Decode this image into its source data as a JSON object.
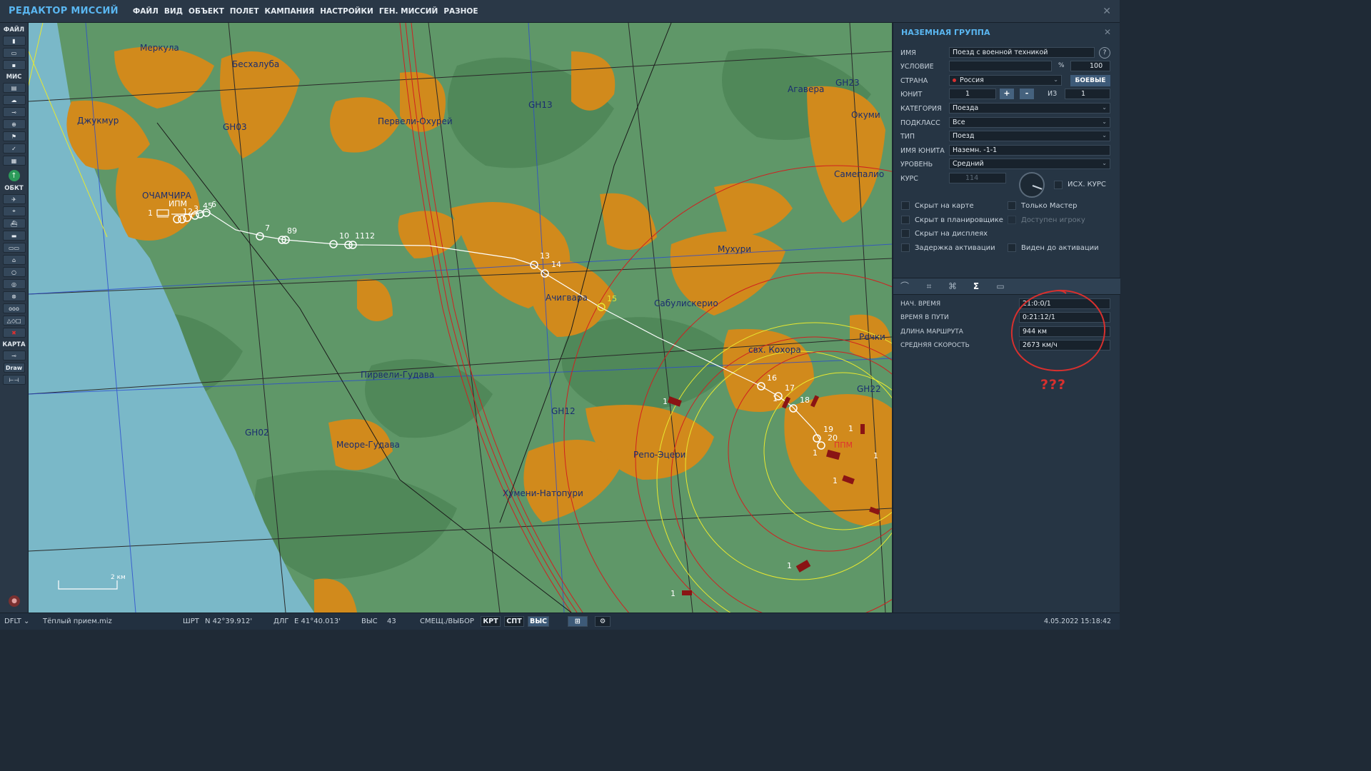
{
  "app": {
    "title": "РЕДАКТОР МИССИЙ"
  },
  "menu": [
    "ФАЙЛ",
    "ВИД",
    "ОБЪЕКТ",
    "ПОЛЕТ",
    "КАМПАНИЯ",
    "НАСТРОЙКИ",
    "ГЕН. МИССИЙ",
    "РАЗНОЕ"
  ],
  "toolbar": {
    "file_label": "ФАЙЛ",
    "mission_label": "МИС",
    "objects_label": "ОБКТ",
    "map_label": "КАРТА",
    "draw_label": "Draw"
  },
  "map": {
    "background_color": "#5f9768",
    "sea_color": "#7ab8c8",
    "town_color": "#d18a1c",
    "towns": [
      "Меркула",
      "Бесхалуба",
      "Джукмур",
      "GH03",
      "ОЧАМЧИРА",
      "Первели-Охурей",
      "GH13",
      "Агавера",
      "GH23",
      "Окуми",
      "Самепалио",
      "Мухури",
      "Сабулискерио",
      "Ачигвара",
      "свх. Кохора",
      "Речки",
      "GH22",
      "Пирвели-Гудава",
      "GH12",
      "GH02",
      "Меоре-Гудава",
      "Репо-Эцери",
      "Хумени-Натопури"
    ],
    "waypoints": [
      "1",
      "12",
      "3",
      "45",
      "6",
      "7",
      "89",
      "10",
      "1112",
      "13",
      "14",
      "15",
      "16",
      "17",
      "18",
      "19",
      "20"
    ],
    "start_label": "ИПМ",
    "end_label": "ППМ",
    "scale_label": "2 км",
    "enemy_labels": [
      "1",
      "1",
      "1",
      "1",
      "1",
      "1",
      "1",
      "1"
    ]
  },
  "panel": {
    "title": "НАЗЕМНАЯ ГРУППА",
    "name_label": "ИМЯ",
    "name_value": "Поезд с военной техникой",
    "help": "?",
    "condition_label": "УСЛОВИЕ",
    "condition_value": "",
    "percent_sign": "%",
    "condition_percent": "100",
    "country_label": "СТРАНА",
    "country_value": "Россия",
    "combat_button": "БОЕВЫЕ",
    "unit_label": "ЮНИТ",
    "unit_value": "1",
    "plus": "+",
    "minus": "-",
    "of_label": "ИЗ",
    "of_value": "1",
    "category_label": "КАТЕГОРИЯ",
    "category_value": "Поезда",
    "subclass_label": "ПОДКЛАСС",
    "subclass_value": "Все",
    "type_label": "ТИП",
    "type_value": "Поезд",
    "unit_name_label": "ИМЯ ЮНИТА",
    "unit_name_value": "Наземн. -1-1",
    "skill_label": "УРОВЕНЬ",
    "skill_value": "Средний",
    "heading_label": "КУРС",
    "heading_value": "114",
    "initial_heading_label": "ИСХ. КУРС",
    "checkboxes": [
      {
        "label": "Скрыт на карте",
        "disabled": false
      },
      {
        "label": "Только Мастер",
        "disabled": false
      },
      {
        "label": "Скрыт в планировщике",
        "disabled": false
      },
      {
        "label": "Доступен игроку",
        "disabled": true
      },
      {
        "label": "Скрыт на дисплеях",
        "disabled": false
      },
      {
        "label": "Задержка активации",
        "disabled": false
      },
      {
        "label": "Виден до активации",
        "disabled": false
      }
    ],
    "tabs": [
      "route-tab-icon",
      "targets-tab-icon",
      "triggers-tab-icon",
      "summary-tab-icon",
      "payload-tab-icon"
    ],
    "active_tab_symbol": "Σ",
    "stats": [
      {
        "label": "НАЧ. ВРЕМЯ",
        "value": "21:0:0/1"
      },
      {
        "label": "ВРЕМЯ В ПУТИ",
        "value": "0:21:12/1"
      },
      {
        "label": "ДЛИНА МАРШРУТА",
        "value": "944 км"
      },
      {
        "label": "СРЕДНЯЯ СКОРОСТЬ",
        "value": "2673 км/ч"
      }
    ],
    "annotation": "???",
    "annotation_color": "#d8302e"
  },
  "status": {
    "profile": "DFLT",
    "filename": "Тёплый прием.miz",
    "lat_label": "ШРТ",
    "lat_value": "N 42°39.912'",
    "lon_label": "ДЛГ",
    "lon_value": "E 41°40.013'",
    "alt_label": "ВЫС",
    "alt_value": "43",
    "mode_label": "СМЕЩ./ВЫБОР",
    "btn_map": "КРТ",
    "btn_sat": "СПТ",
    "btn_alt": "ВЫС",
    "datetime": "4.05.2022 15:18:42"
  }
}
